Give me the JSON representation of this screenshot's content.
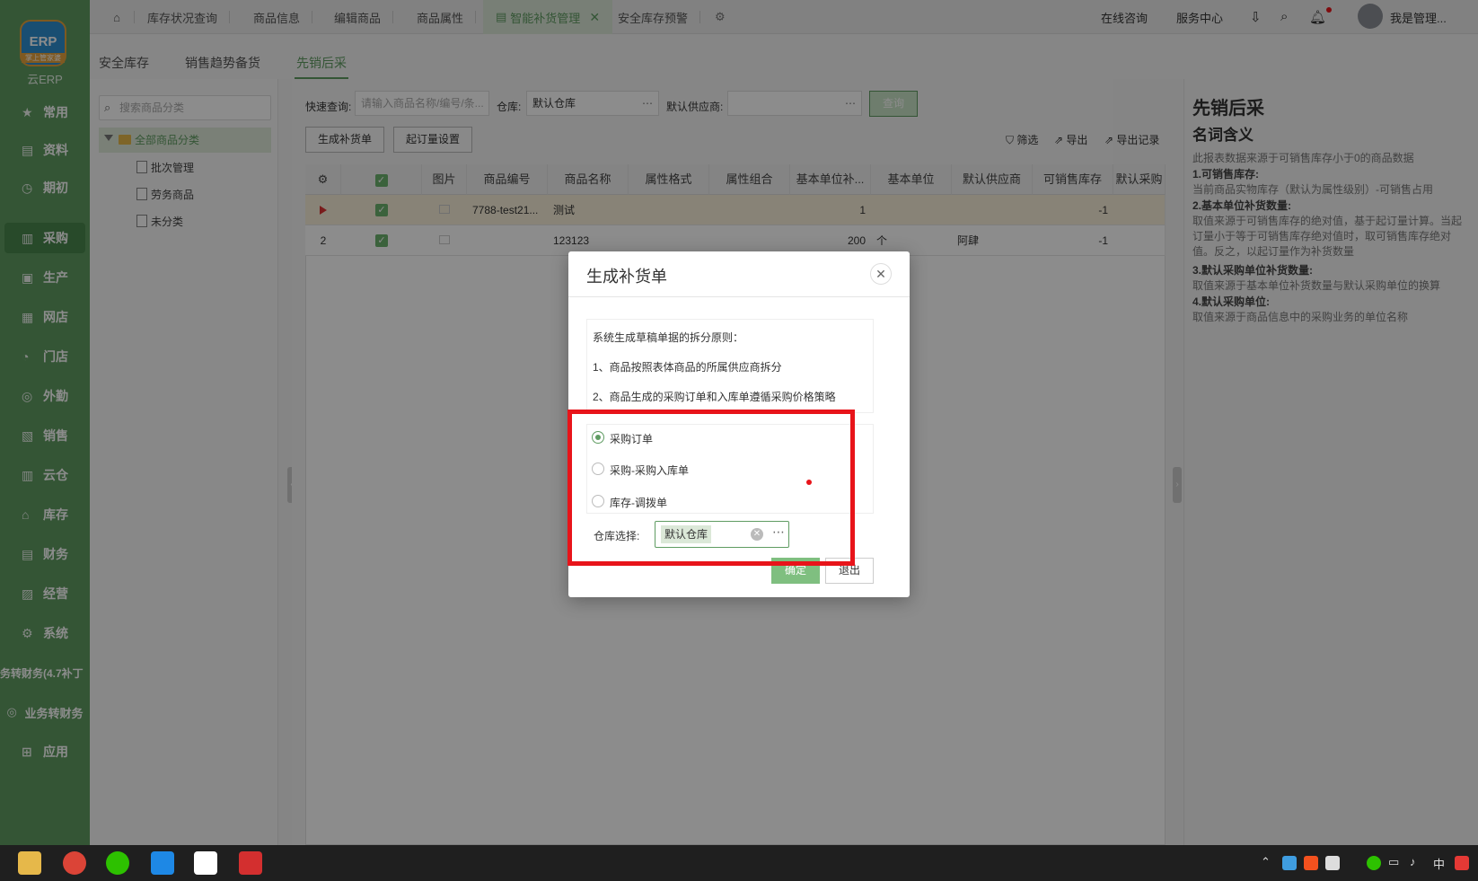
{
  "app": {
    "name": "云ERP",
    "logo_text": "ERP",
    "logo_sub": "掌上管家婆"
  },
  "sidebar": {
    "items": [
      {
        "label": "常用"
      },
      {
        "label": "资料"
      },
      {
        "label": "期初"
      },
      {
        "label": "采购"
      },
      {
        "label": "生产"
      },
      {
        "label": "网店"
      },
      {
        "label": "门店"
      },
      {
        "label": "外勤"
      },
      {
        "label": "销售"
      },
      {
        "label": "云仓"
      },
      {
        "label": "库存"
      },
      {
        "label": "财务"
      },
      {
        "label": "经营"
      },
      {
        "label": "系统"
      },
      {
        "label": "务转财务(4.7补丁"
      },
      {
        "label": "业务转财务"
      },
      {
        "label": "应用"
      }
    ]
  },
  "topbar": {
    "tabs": [
      "库存状况查询",
      "商品信息",
      "编辑商品",
      "商品属性",
      "智能补货管理",
      "安全库存预警"
    ],
    "online": "在线咨询",
    "service": "服务中心",
    "user": "我是管理..."
  },
  "subtabs": [
    "安全库存",
    "销售趋势备货",
    "先销后采"
  ],
  "category": {
    "search_placeholder": "搜索商品分类",
    "root": "全部商品分类",
    "items": [
      "批次管理",
      "劳务商品",
      "未分类"
    ]
  },
  "filters": {
    "quick_label": "快速查询:",
    "quick_placeholder": "请输入商品名称/编号/条...",
    "warehouse_label": "仓库:",
    "warehouse_value": "默认仓库",
    "supplier_label": "默认供应商:",
    "query_button": "查询"
  },
  "toolbar": {
    "gen_button": "生成补货单",
    "moq_button": "起订量设置",
    "filter": "筛选",
    "export": "导出",
    "export_log": "导出记录"
  },
  "table": {
    "headers": [
      "图片",
      "商品编号",
      "商品名称",
      "属性格式",
      "属性组合",
      "基本单位补...",
      "基本单位",
      "默认供应商",
      "可销售库存",
      "默认采购"
    ],
    "rows": [
      {
        "no": "",
        "code": "7788-test21...",
        "name": "测试",
        "qty": "1",
        "unit": "",
        "supplier": "",
        "stock": "-1"
      },
      {
        "no": "2",
        "code": "",
        "name": "123123",
        "qty": "200",
        "unit": "个",
        "supplier": "阿肆",
        "stock": "-1"
      }
    ]
  },
  "help": {
    "title": "先销后采",
    "subtitle": "名词含义",
    "intro": "此报表数据来源于可销售库存小于0的商品数据",
    "h1": "1.可销售库存:",
    "t1": "当前商品实物库存（默认为属性级别）-可销售占用",
    "h2": "2.基本单位补货数量:",
    "t2": "取值来源于可销售库存的绝对值，基于起订量计算。当起订量小于等于可销售库存绝对值时，取可销售库存绝对值。反之，以起订量作为补货数量",
    "h3": "3.默认采购单位补货数量:",
    "t3": "取值来源于基本单位补货数量与默认采购单位的换算",
    "h4": "4.默认采购单位:",
    "t4": "取值来源于商品信息中的采购业务的单位名称"
  },
  "modal": {
    "title": "生成补货单",
    "rule_title": "系统生成草稿单据的拆分原则：",
    "rule1": "1、商品按照表体商品的所属供应商拆分",
    "rule2": "2、商品生成的采购订单和入库单遵循采购价格策略",
    "options": [
      "采购订单",
      "采购-采购入库单",
      "库存-调拨单"
    ],
    "selected_option": "采购订单",
    "warehouse_label": "仓库选择:",
    "warehouse_value": "默认仓库",
    "ok": "确定",
    "exit": "退出"
  },
  "taskbar": {
    "ime": "中"
  },
  "colors": {
    "brand": "#5f9c62",
    "highlight": "#e8141a"
  }
}
